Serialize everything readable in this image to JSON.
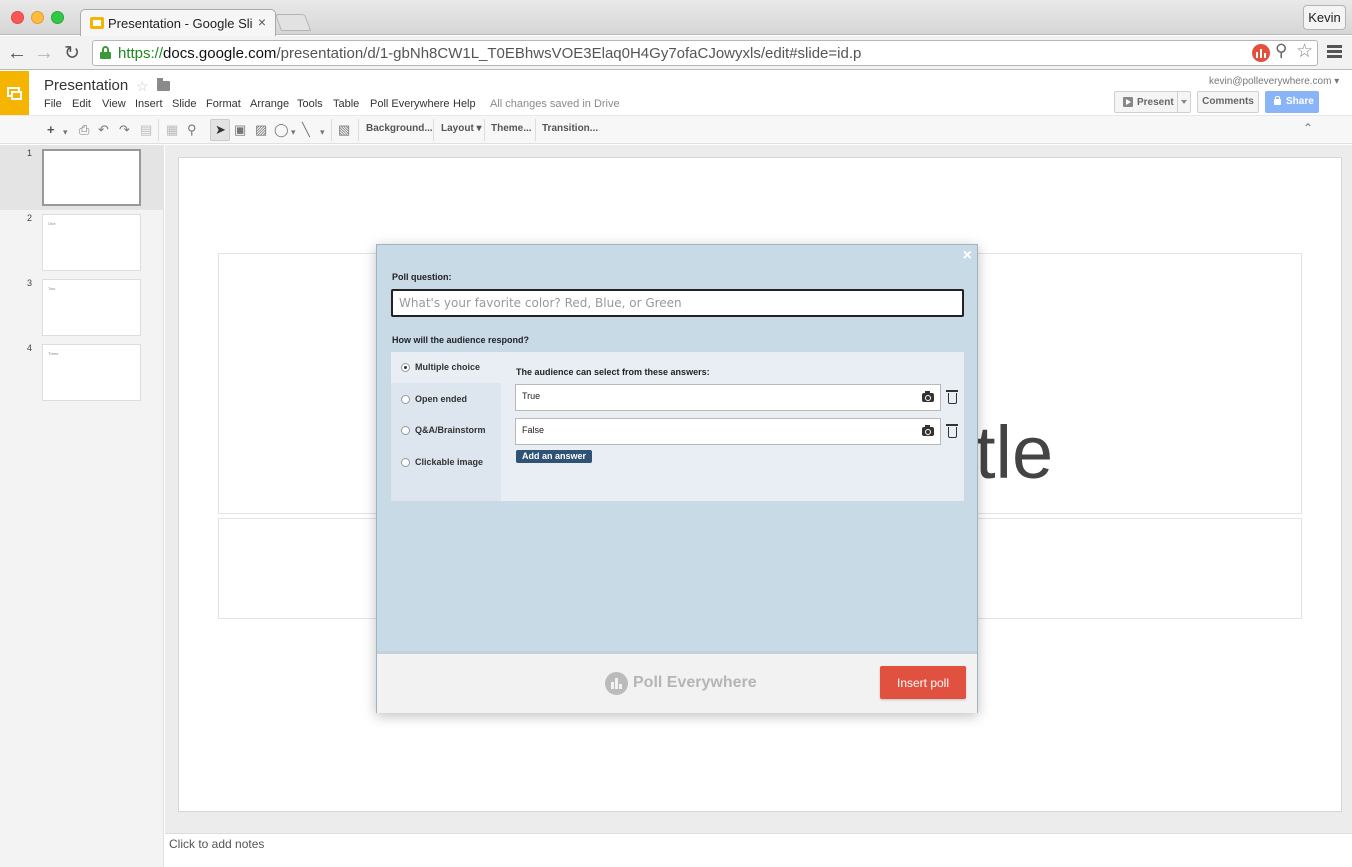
{
  "browser": {
    "tab_title": "Presentation - Google Slides",
    "tab_close": "×",
    "profile": "Kevin",
    "url_scheme": "https://",
    "url_host": "docs.google.com",
    "url_path": "/presentation/d/1-gbNh8CW1L_T0EBhwsVOE3Elaq0H4Gy7ofaCJowyxls/edit#slide=id.p",
    "icons": {
      "back": "arrow-left",
      "forward": "arrow-right",
      "reload": "reload",
      "search": "magnifier",
      "star": "star",
      "menu": "hamburger"
    }
  },
  "app": {
    "doc_title": "Presentation",
    "menu": [
      "File",
      "Edit",
      "View",
      "Insert",
      "Slide",
      "Format",
      "Arrange",
      "Tools",
      "Table",
      "Poll Everywhere",
      "Help"
    ],
    "save_status": "All changes saved in Drive",
    "account": "kevin@polleverywhere.com ▾",
    "present_label": "Present",
    "comments_label": "Comments",
    "share_label": "Share",
    "accent": "#f4b400"
  },
  "toolbar": {
    "background": "Background...",
    "layout": "Layout ▾",
    "theme": "Theme...",
    "transition": "Transition..."
  },
  "filmstrip": [
    {
      "num": "1",
      "text": ""
    },
    {
      "num": "2",
      "text": "One"
    },
    {
      "num": "3",
      "text": "Two"
    },
    {
      "num": "4",
      "text": "Three"
    }
  ],
  "slide": {
    "visible_title_fragment": "tle"
  },
  "notes": {
    "placeholder": "Click to add notes"
  },
  "poll_dialog": {
    "close": "×",
    "question_label": "Poll question:",
    "question_placeholder": "What's your favorite color? Red, Blue, or Green",
    "respond_label": "How will the audience respond?",
    "response_types": [
      {
        "label": "Multiple choice",
        "selected": true
      },
      {
        "label": "Open ended",
        "selected": false
      },
      {
        "label": "Q&A/Brainstorm",
        "selected": false
      },
      {
        "label": "Clickable image",
        "selected": false
      }
    ],
    "answers_label": "The audience can select from these answers:",
    "answers": [
      "True",
      "False"
    ],
    "add_answer": "Add an answer",
    "brand": "Poll Everywhere",
    "insert_button": "Insert poll",
    "insert_color": "#e0513f"
  }
}
